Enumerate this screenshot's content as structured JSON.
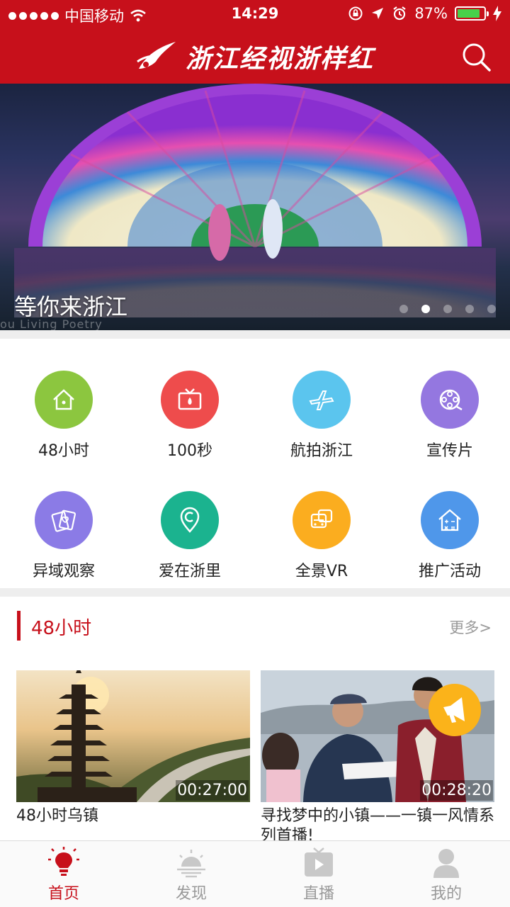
{
  "status": {
    "carrier": "中国移动",
    "time": "14:29",
    "battery": "87%",
    "battery_level": 0.87
  },
  "header": {
    "title": "浙江经视浙样红"
  },
  "banner": {
    "title": "等你来浙江",
    "watermark": "ou Living Poetry",
    "pages": 5,
    "active_page": 1
  },
  "grid": [
    {
      "label": "48小时",
      "icon": "house-icon",
      "color": "#8cc63f"
    },
    {
      "label": "100秒",
      "icon": "tv-icon",
      "color": "#ee4c4c"
    },
    {
      "label": "航拍浙江",
      "icon": "airplane-icon",
      "color": "#5bc5ee"
    },
    {
      "label": "宣传片",
      "icon": "film-reel-icon",
      "color": "#9477e0"
    },
    {
      "label": "异域观察",
      "icon": "cards-icon",
      "color": "#8b7be6"
    },
    {
      "label": "爱在浙里",
      "icon": "location-pin-icon",
      "color": "#1bb38f"
    },
    {
      "label": "全景VR",
      "icon": "bus-icon",
      "color": "#fbad1f"
    },
    {
      "label": "推广活动",
      "icon": "calculator-house-icon",
      "color": "#4f97ea"
    }
  ],
  "section": {
    "title": "48小时",
    "more": "更多>"
  },
  "videos": [
    {
      "title": "48小时乌镇",
      "duration": "00:27:00"
    },
    {
      "title": "寻找梦中的小镇——一镇一风情系列首播!",
      "duration": "00:28:20"
    }
  ],
  "tabs": [
    {
      "label": "首页",
      "icon": "lightbulb-icon",
      "active": true
    },
    {
      "label": "发现",
      "icon": "sunset-icon",
      "active": false
    },
    {
      "label": "直播",
      "icon": "tv-play-icon",
      "active": false
    },
    {
      "label": "我的",
      "icon": "user-icon",
      "active": false
    }
  ],
  "colors": {
    "brand_red": "#c7101b",
    "megaphone": "#fbb31a"
  }
}
